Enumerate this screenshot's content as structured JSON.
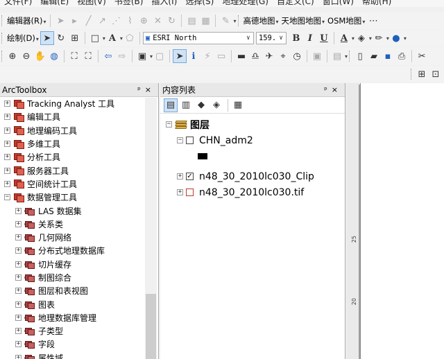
{
  "menubar": [
    "文件(F)",
    "编辑(E)",
    "视图(V)",
    "书签(B)",
    "插入(I)",
    "选择(S)",
    "地理处理(G)",
    "自定义(C)",
    "窗口(W)",
    "帮助(H)"
  ],
  "toolbar1": {
    "editor_label": "编辑器(R)",
    "gaode_label": "高德地图",
    "tianditu_label": "天地图地图",
    "osm_label": "OSM地图"
  },
  "toolbar2": {
    "draw_label": "绘制(D)",
    "font_name": "ESRI North",
    "font_size": "159."
  },
  "arctoolbox": {
    "title": "ArcToolbox",
    "controls": "ᵖ ×",
    "items": [
      {
        "label": "Tracking Analyst 工具",
        "level": 0,
        "expand": "+"
      },
      {
        "label": "编辑工具",
        "level": 0,
        "expand": "+"
      },
      {
        "label": "地理编码工具",
        "level": 0,
        "expand": "+"
      },
      {
        "label": "多维工具",
        "level": 0,
        "expand": "+"
      },
      {
        "label": "分析工具",
        "level": 0,
        "expand": "+"
      },
      {
        "label": "服务器工具",
        "level": 0,
        "expand": "+"
      },
      {
        "label": "空间统计工具",
        "level": 0,
        "expand": "+"
      },
      {
        "label": "数据管理工具",
        "level": 0,
        "expand": "−"
      },
      {
        "label": "LAS 数据集",
        "level": 1,
        "expand": "+"
      },
      {
        "label": "关系类",
        "level": 1,
        "expand": "+"
      },
      {
        "label": "几何网络",
        "level": 1,
        "expand": "+"
      },
      {
        "label": "分布式地理数据库",
        "level": 1,
        "expand": "+"
      },
      {
        "label": "切片缓存",
        "level": 1,
        "expand": "+"
      },
      {
        "label": "制图综合",
        "level": 1,
        "expand": "+"
      },
      {
        "label": "图层和表视图",
        "level": 1,
        "expand": "+"
      },
      {
        "label": "图表",
        "level": 1,
        "expand": "+"
      },
      {
        "label": "地理数据库管理",
        "level": 1,
        "expand": "+"
      },
      {
        "label": "子类型",
        "level": 1,
        "expand": "+"
      },
      {
        "label": "字段",
        "level": 1,
        "expand": "+"
      },
      {
        "label": "属性域",
        "level": 1,
        "expand": "+"
      }
    ]
  },
  "toc": {
    "title": "内容列表",
    "controls": "ᵖ ×",
    "root_label": "图层",
    "layers": [
      {
        "name": "CHN_adm2",
        "checked": "",
        "expand": "−",
        "symbol": true
      },
      {
        "name": "n48_30_2010lc030_Clip",
        "checked": "✓",
        "expand": "+",
        "symbol": false
      },
      {
        "name": "n48_30_2010lc030.tif",
        "checked": "",
        "expand": "+",
        "symbol": false
      }
    ]
  },
  "ruler": {
    "mark1": "25",
    "mark2": "20"
  }
}
